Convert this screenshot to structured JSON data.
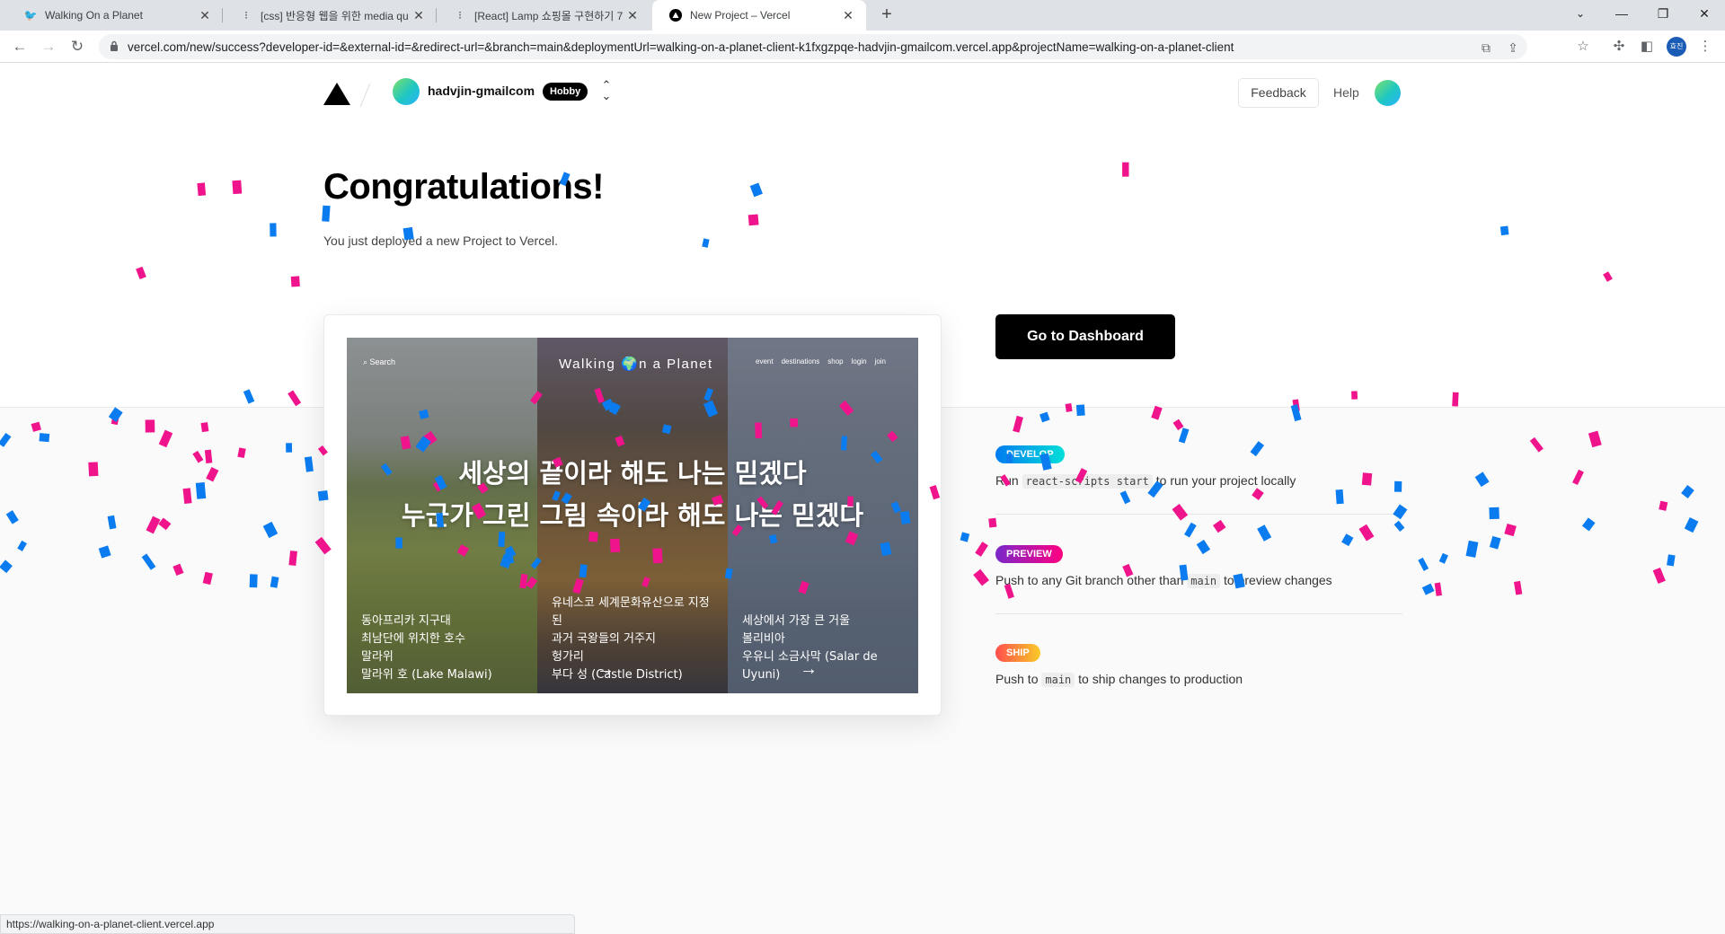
{
  "browser": {
    "tabs": [
      {
        "title": "Walking On a Planet",
        "favicon": "bird-icon"
      },
      {
        "title": "[css] 반응형 웹을 위한 media qu",
        "favicon": "velog-icon"
      },
      {
        "title": "[React] Lamp 쇼핑몰 구현하기 7",
        "favicon": "velog-icon"
      },
      {
        "title": "New Project – Vercel",
        "favicon": "vercel-icon"
      }
    ],
    "url": "vercel.com/new/success?developer-id=&external-id=&redirect-url=&branch=main&deploymentUrl=walking-on-a-planet-client-k1fxgzpqe-hadvjin-gmailcom.vercel.app&projectName=walking-on-a-planet-client",
    "profile_initials": "효진",
    "status_url": "https://walking-on-a-planet-client.vercel.app"
  },
  "header": {
    "account": "hadvjin-gmailcom",
    "plan_badge": "Hobby",
    "feedback": "Feedback",
    "help": "Help"
  },
  "hero": {
    "title": "Congratulations!",
    "subtitle": "You just deployed a new Project to Vercel."
  },
  "preview": {
    "search": "Search",
    "brand": "Walking 🌍n a Planet",
    "nav": [
      "event",
      "destinations",
      "shop",
      "login",
      "join"
    ],
    "headline_1": "세상의 끝이라 해도 나는 믿겠다",
    "headline_2": "누군가 그린 그림 속이라 해도 나는 믿겠다",
    "caption_1": [
      "동아프리카 지구대",
      "최남단에 위치한 호수",
      "말라위",
      "말라위 호 (Lake Malawi)"
    ],
    "caption_2": [
      "유네스코 세계문화유산으로 지정",
      "된",
      "과거 국왕들의 거주지",
      "헝가리",
      "부다 성 (Castle District)"
    ],
    "caption_3": [
      "세상에서 가장 큰 거울",
      "볼리비아",
      "우유니 소금사막 (Salar de",
      "Uyuni)"
    ]
  },
  "cta": {
    "dashboard": "Go to Dashboard"
  },
  "steps": {
    "develop": {
      "badge": "DEVELOP",
      "pre": "Run",
      "code": "react-scripts start",
      "post": "to run your project locally"
    },
    "preview": {
      "badge": "PREVIEW",
      "pre": "Push to any Git branch other than",
      "code": "main",
      "post": "to preview changes"
    },
    "ship": {
      "badge": "SHIP",
      "pre": "Push to",
      "code": "main",
      "post": "to ship changes to production"
    }
  },
  "colors": {
    "confetti_pink": "#f0148c",
    "confetti_blue": "#0a7cf0",
    "accent": "#000000"
  }
}
